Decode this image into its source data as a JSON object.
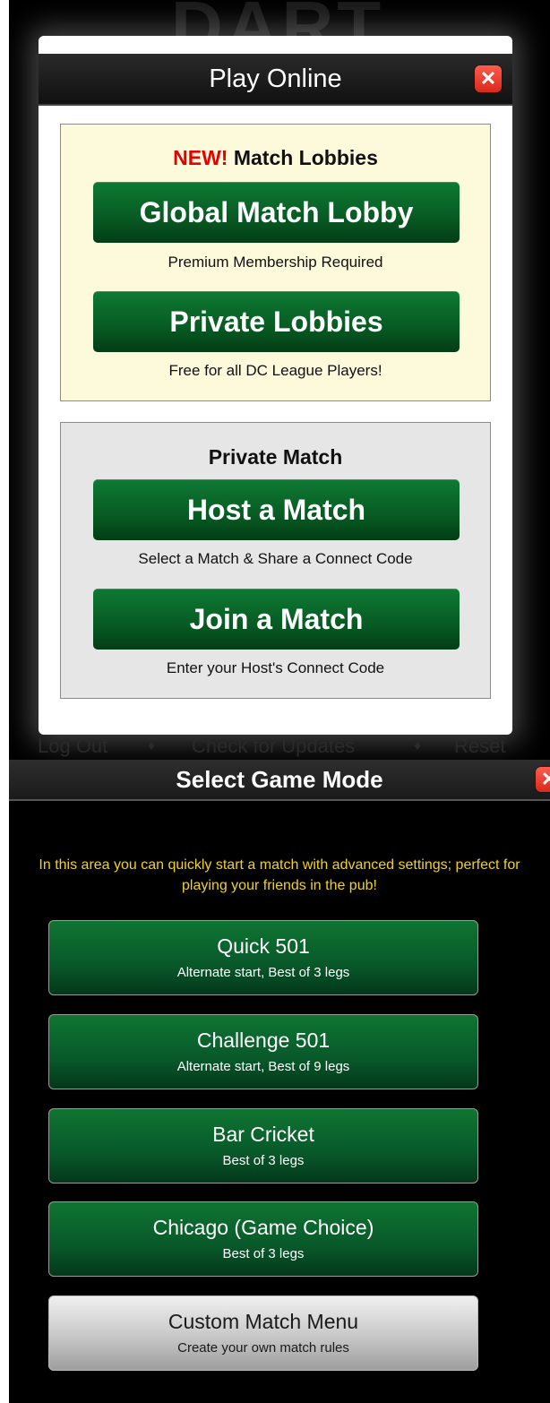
{
  "background": {
    "title": "DART"
  },
  "play_online": {
    "title": "Play Online",
    "close_glyph": "✕",
    "lobbies": {
      "new_tag": "NEW!",
      "heading": "Match Lobbies",
      "global_button": "Global Match Lobby",
      "global_caption": "Premium Membership Required",
      "private_button": "Private Lobbies",
      "private_caption": "Free for all DC League Players!"
    },
    "private_match": {
      "heading": "Private Match",
      "host_button": "Host a Match",
      "host_caption": "Select a Match & Share a Connect Code",
      "join_button": "Join a Match",
      "join_caption": "Enter your Host's Connect Code"
    }
  },
  "links": {
    "logout": "Log Out",
    "sep": "♦",
    "updates": "Check for Updates",
    "reset": "Reset"
  },
  "game_mode": {
    "title": "Select Game Mode",
    "close_glyph": "✕",
    "intro": "In this area you can quickly start a match with advanced settings; perfect for playing your friends in the pub!",
    "modes": [
      {
        "label": "Quick 501",
        "sub": "Alternate start, Best of 3 legs"
      },
      {
        "label": "Challenge 501",
        "sub": "Alternate start, Best of 9 legs"
      },
      {
        "label": "Bar Cricket",
        "sub": "Best of 3 legs"
      },
      {
        "label": "Chicago (Game Choice)",
        "sub": "Best of 3 legs"
      },
      {
        "label": "Custom Match Menu",
        "sub": "Create your own match rules"
      }
    ]
  },
  "colors": {
    "accent_green": "#075a23",
    "new_red": "#e60000",
    "intro_yellow": "#f2d21a",
    "close_red": "#d9291b"
  }
}
